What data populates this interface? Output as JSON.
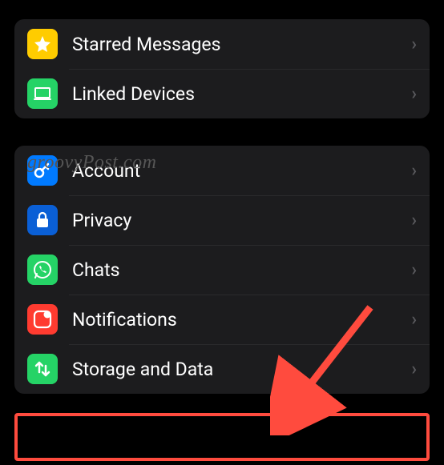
{
  "watermark": "groovyPost.com",
  "group1": {
    "items": [
      {
        "icon": "star-icon",
        "label": "Starred Messages"
      },
      {
        "icon": "laptop-icon",
        "label": "Linked Devices"
      }
    ]
  },
  "group2": {
    "items": [
      {
        "icon": "key-icon",
        "label": "Account"
      },
      {
        "icon": "lock-icon",
        "label": "Privacy"
      },
      {
        "icon": "whatsapp-icon",
        "label": "Chats"
      },
      {
        "icon": "notification-icon",
        "label": "Notifications"
      },
      {
        "icon": "data-icon",
        "label": "Storage and Data"
      }
    ]
  }
}
